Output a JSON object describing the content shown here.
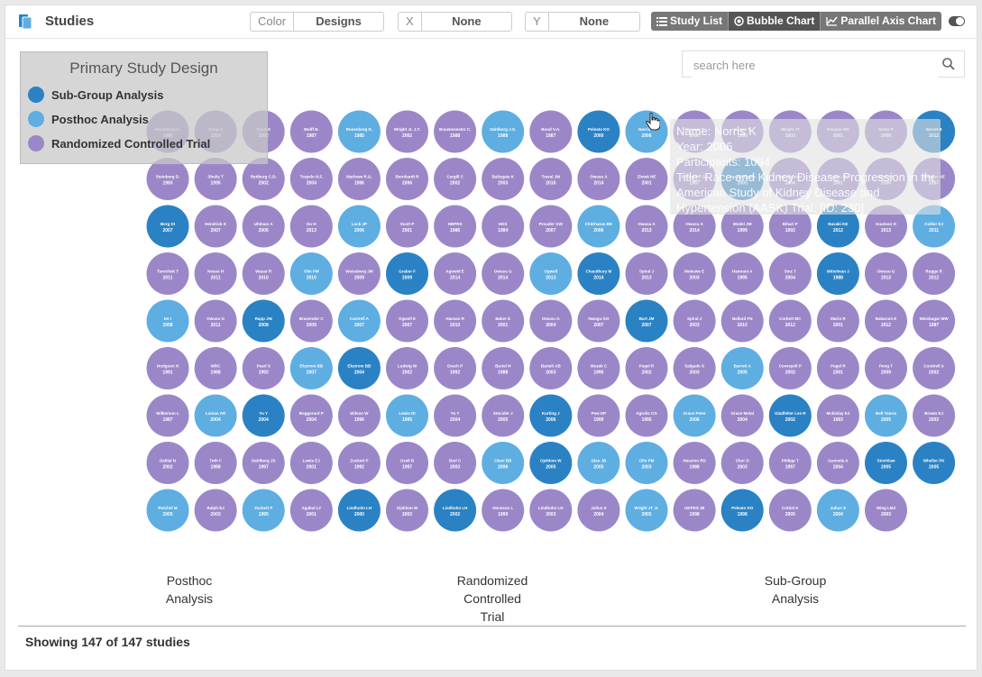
{
  "header": {
    "title": "Studies",
    "color_select": {
      "label": "Color",
      "value": "Designs"
    },
    "x_select": {
      "label": "X",
      "value": "None"
    },
    "y_select": {
      "label": "Y",
      "value": "None"
    },
    "view_buttons": [
      "Study List",
      "Bubble Chart",
      "Parallel Axis Chart"
    ],
    "active_view": "Bubble Chart"
  },
  "search": {
    "placeholder": "search here",
    "value": ""
  },
  "legend": {
    "title": "Primary Study Design",
    "items": [
      {
        "label": "Sub-Group Analysis",
        "color": "#2a82c4"
      },
      {
        "label": "Posthoc Analysis",
        "color": "#5eaee2"
      },
      {
        "label": "Randomized Controlled Trial",
        "color": "#9b87c8"
      }
    ]
  },
  "tooltip": {
    "lines": [
      "Name: Norris K",
      "Year: 2006",
      "Participants: 1094",
      "Title: Race and Kidney Disease Progression in the African",
      "American Study of Kidney Disease and",
      "Hypertension (AASK) Trial. [ID: 230]"
    ]
  },
  "group_labels": [
    {
      "lines": [
        "Posthoc",
        "Analysis"
      ]
    },
    {
      "lines": [
        "Randomized",
        "Controlled",
        "Trial"
      ]
    },
    {
      "lines": [
        "Sub-Group",
        "Analysis"
      ]
    }
  ],
  "footer": {
    "status": "Showing 147 of 147 studies"
  },
  "chart_data": {
    "type": "scatter",
    "title": "",
    "xlabel": "",
    "ylabel": "",
    "bubbles": [
      {
        "name": "Hirschhorn L",
        "year": "1986",
        "design": "R"
      },
      {
        "name": "Kang H",
        "year": "1993",
        "design": "R"
      },
      {
        "name": "Pearl S",
        "year": "1992",
        "design": "R"
      },
      {
        "name": "Wolff B.",
        "year": "1987",
        "design": "R"
      },
      {
        "name": "Rosenberg D.",
        "year": "1985",
        "design": "P"
      },
      {
        "name": "Wright Jr. J.T.",
        "year": "2002",
        "design": "R"
      },
      {
        "name": "Bouwmeester C.",
        "year": "1988",
        "design": "R"
      },
      {
        "name": "Dahlberg J.S.",
        "year": "1988",
        "design": "P"
      },
      {
        "name": "Bond V.A.",
        "year": "1987",
        "design": "R"
      },
      {
        "name": "Peleato KO",
        "year": "2000",
        "design": "S"
      },
      {
        "name": "Norris K",
        "year": "2006",
        "design": "P"
      },
      {
        "name": "Duncan T",
        "year": "2006",
        "design": "R"
      },
      {
        "name": "Grimm R",
        "year": "1998",
        "design": "R"
      },
      {
        "name": "Wright JT",
        "year": "2003",
        "design": "R"
      },
      {
        "name": "Kenyon RR",
        "year": "2001",
        "design": "R"
      },
      {
        "name": "Greer P",
        "year": "2006",
        "design": "R"
      },
      {
        "name": "Wendt B",
        "year": "2012",
        "design": "S"
      },
      {
        "name": "Steinberg D.",
        "year": "1993",
        "design": "R"
      },
      {
        "name": "Shultz T",
        "year": "1995",
        "design": "R"
      },
      {
        "name": "Rettberg C.D.",
        "year": "2002",
        "design": "R"
      },
      {
        "name": "Torpelo H.F.",
        "year": "2004",
        "design": "R"
      },
      {
        "name": "Marlowe R.G.",
        "year": "1986",
        "design": "R"
      },
      {
        "name": "Bernhardt R",
        "year": "2006",
        "design": "R"
      },
      {
        "name": "Cargill C",
        "year": "2002",
        "design": "R"
      },
      {
        "name": "Baltzgate K",
        "year": "2003",
        "design": "R"
      },
      {
        "name": "Traval JM",
        "year": "2016",
        "design": "R"
      },
      {
        "name": "Owusu A",
        "year": "2014",
        "design": "R"
      },
      {
        "name": "Zlotek NE",
        "year": "2001",
        "design": "R"
      },
      {
        "name": "Schneider GF",
        "year": "1987",
        "design": "R"
      },
      {
        "name": "Agaleb Bowie",
        "year": "2005",
        "design": "S"
      },
      {
        "name": "Del Winston",
        "year": "2004",
        "design": "R"
      },
      {
        "name": "Totten JM",
        "year": "2001",
        "design": "R"
      },
      {
        "name": "Bosch P",
        "year": "2006",
        "design": "R"
      },
      {
        "name": "Brenner AE",
        "year": "1987",
        "design": "R"
      },
      {
        "name": "Berg DI",
        "year": "2007",
        "design": "S"
      },
      {
        "name": "Hendrick K",
        "year": "2007",
        "design": "R"
      },
      {
        "name": "Uhlman A",
        "year": "2006",
        "design": "R"
      },
      {
        "name": "Do H",
        "year": "2013",
        "design": "R"
      },
      {
        "name": "Lock JP",
        "year": "2006",
        "design": "P"
      },
      {
        "name": "Scott P",
        "year": "2001",
        "design": "R"
      },
      {
        "name": "HBPRS",
        "year": "1986",
        "design": "R"
      },
      {
        "name": "HDS",
        "year": "1984",
        "design": "R"
      },
      {
        "name": "Prouder GW",
        "year": "2007",
        "design": "R"
      },
      {
        "name": "Chitrharan BK",
        "year": "2006",
        "design": "P"
      },
      {
        "name": "Owusu A",
        "year": "2013",
        "design": "R"
      },
      {
        "name": "Owusu A",
        "year": "2014",
        "design": "R"
      },
      {
        "name": "Model JM",
        "year": "1999",
        "design": "R"
      },
      {
        "name": "Bihari P",
        "year": "1992",
        "design": "R"
      },
      {
        "name": "Bavaki KE",
        "year": "2012",
        "design": "S"
      },
      {
        "name": "Kauteon H",
        "year": "2013",
        "design": "R"
      },
      {
        "name": "Collier EJ",
        "year": "2011",
        "design": "P"
      },
      {
        "name": "Turechek T",
        "year": "2011",
        "design": "R"
      },
      {
        "name": "Nesso H",
        "year": "2011",
        "design": "R"
      },
      {
        "name": "Wasar R",
        "year": "2010",
        "design": "R"
      },
      {
        "name": "Olin PM",
        "year": "2010",
        "design": "P"
      },
      {
        "name": "Weissberg JM",
        "year": "2009",
        "design": "R"
      },
      {
        "name": "Graber F",
        "year": "2009",
        "design": "S"
      },
      {
        "name": "Agowid E",
        "year": "2014",
        "design": "R"
      },
      {
        "name": "Owusu G",
        "year": "2014",
        "design": "R"
      },
      {
        "name": "Ogwell",
        "year": "2013",
        "design": "P"
      },
      {
        "name": "Chaudhury M",
        "year": "2014",
        "design": "S"
      },
      {
        "name": "Spiral J",
        "year": "2013",
        "design": "R"
      },
      {
        "name": "Mokuwe E",
        "year": "2003",
        "design": "R"
      },
      {
        "name": "Hamrani A",
        "year": "1995",
        "design": "R"
      },
      {
        "name": "Sinz T",
        "year": "2004",
        "design": "R"
      },
      {
        "name": "Mittelman J",
        "year": "1988",
        "design": "S"
      },
      {
        "name": "Owusu G",
        "year": "2013",
        "design": "R"
      },
      {
        "name": "Rugge R",
        "year": "2012",
        "design": "R"
      },
      {
        "name": "Do I",
        "year": "2008",
        "design": "P"
      },
      {
        "name": "Owusu G",
        "year": "2011",
        "design": "R"
      },
      {
        "name": "Rapp JW",
        "year": "2008",
        "design": "S"
      },
      {
        "name": "Bravender C",
        "year": "2009",
        "design": "R"
      },
      {
        "name": "Cantrell A",
        "year": "2007",
        "design": "P"
      },
      {
        "name": "Ogwell E",
        "year": "2007",
        "design": "R"
      },
      {
        "name": "Hassan R",
        "year": "2010",
        "design": "R"
      },
      {
        "name": "Baker E",
        "year": "2001",
        "design": "R"
      },
      {
        "name": "Owusu G",
        "year": "2004",
        "design": "R"
      },
      {
        "name": "Nwagu GO",
        "year": "2007",
        "design": "R"
      },
      {
        "name": "Burt JM",
        "year": "2007",
        "design": "S"
      },
      {
        "name": "Spiral J",
        "year": "2003",
        "design": "R"
      },
      {
        "name": "Ballard FN",
        "year": "2010",
        "design": "R"
      },
      {
        "name": "Corbett MC",
        "year": "2012",
        "design": "R"
      },
      {
        "name": "Marin R",
        "year": "2001",
        "design": "R"
      },
      {
        "name": "Bakarum E",
        "year": "2012",
        "design": "R"
      },
      {
        "name": "Weisbagar MW",
        "year": "1987",
        "design": "R"
      },
      {
        "name": "Hodgson H",
        "year": "1991",
        "design": "R"
      },
      {
        "name": "MRC",
        "year": "1988",
        "design": "R"
      },
      {
        "name": "Pearl S",
        "year": "1992",
        "design": "R"
      },
      {
        "name": "Ekstrom BB",
        "year": "2007",
        "design": "P"
      },
      {
        "name": "Ekstrom BB",
        "year": "2004",
        "design": "S"
      },
      {
        "name": "Ludwig W",
        "year": "2002",
        "design": "R"
      },
      {
        "name": "Drach P",
        "year": "1992",
        "design": "R"
      },
      {
        "name": "Bartel H",
        "year": "1988",
        "design": "R"
      },
      {
        "name": "Bartelt AB",
        "year": "2003",
        "design": "R"
      },
      {
        "name": "Wezek C",
        "year": "1995",
        "design": "R"
      },
      {
        "name": "Pagel R",
        "year": "2002",
        "design": "R"
      },
      {
        "name": "Salgado S",
        "year": "2003",
        "design": "R"
      },
      {
        "name": "Barrett A",
        "year": "2005",
        "design": "P"
      },
      {
        "name": "Coverpoll P",
        "year": "2002",
        "design": "R"
      },
      {
        "name": "Pagel R",
        "year": "2001",
        "design": "R"
      },
      {
        "name": "Peng T",
        "year": "2009",
        "design": "R"
      },
      {
        "name": "Condrell A",
        "year": "2002",
        "design": "R"
      },
      {
        "name": "Wilkerson L",
        "year": "1987",
        "design": "R"
      },
      {
        "name": "Luman AR",
        "year": "2004",
        "design": "P"
      },
      {
        "name": "Yu Y",
        "year": "2004",
        "design": "S"
      },
      {
        "name": "Boggerard P",
        "year": "2004",
        "design": "R"
      },
      {
        "name": "Wilson W",
        "year": "1996",
        "design": "R"
      },
      {
        "name": "Lewis DI",
        "year": "1995",
        "design": "P"
      },
      {
        "name": "Yu Y",
        "year": "2004",
        "design": "R"
      },
      {
        "name": "Stocider J",
        "year": "2005",
        "design": "R"
      },
      {
        "name": "Kurting J",
        "year": "2006",
        "design": "S"
      },
      {
        "name": "Pew DP",
        "year": "1999",
        "design": "R"
      },
      {
        "name": "Agrolis CG",
        "year": "1995",
        "design": "R"
      },
      {
        "name": "Grace Peter",
        "year": "2006",
        "design": "P"
      },
      {
        "name": "Grace Metal",
        "year": "2004",
        "design": "R"
      },
      {
        "name": "Gladfelter Lee R",
        "year": "2002",
        "design": "S"
      },
      {
        "name": "Mckinlay EJ",
        "year": "1993",
        "design": "R"
      },
      {
        "name": "Bell Tamra",
        "year": "2005",
        "design": "P"
      },
      {
        "name": "Brown EJ",
        "year": "2002",
        "design": "R"
      },
      {
        "name": "Dahlal N",
        "year": "2002",
        "design": "R"
      },
      {
        "name": "Toth F",
        "year": "1988",
        "design": "R"
      },
      {
        "name": "Dahlberg JS",
        "year": "1997",
        "design": "R"
      },
      {
        "name": "Lewis EJ",
        "year": "2001",
        "design": "R"
      },
      {
        "name": "Zuckett P",
        "year": "1992",
        "design": "R"
      },
      {
        "name": "Ozell B",
        "year": "1997",
        "design": "R"
      },
      {
        "name": "Barl C",
        "year": "2003",
        "design": "R"
      },
      {
        "name": "Olani BB",
        "year": "2006",
        "design": "P"
      },
      {
        "name": "Ojeblom W",
        "year": "2005",
        "design": "S"
      },
      {
        "name": "Glee JB",
        "year": "2005",
        "design": "P"
      },
      {
        "name": "Olin PM",
        "year": "2003",
        "design": "P"
      },
      {
        "name": "Hession RD",
        "year": "1988",
        "design": "R"
      },
      {
        "name": "Chui JI",
        "year": "2003",
        "design": "R"
      },
      {
        "name": "Philipp T",
        "year": "1997",
        "design": "R"
      },
      {
        "name": "Gunnels A",
        "year": "2004",
        "design": "R"
      },
      {
        "name": "Stochlaw",
        "year": "2005",
        "design": "S"
      },
      {
        "name": "Wheller PK",
        "year": "2005",
        "design": "S"
      },
      {
        "name": "Retchel M",
        "year": "2005",
        "design": "P"
      },
      {
        "name": "Ralph EJ",
        "year": "2003",
        "design": "R"
      },
      {
        "name": "Zuckett P",
        "year": "1995",
        "design": "P"
      },
      {
        "name": "Agabul LY",
        "year": "2001",
        "design": "R"
      },
      {
        "name": "Lindholm LH",
        "year": "2000",
        "design": "S"
      },
      {
        "name": "Ojeblom W",
        "year": "2002",
        "design": "R"
      },
      {
        "name": "Lindholm LH",
        "year": "2002",
        "design": "S"
      },
      {
        "name": "Hansson L",
        "year": "1999",
        "design": "R"
      },
      {
        "name": "Lindholm LH",
        "year": "2003",
        "design": "R"
      },
      {
        "name": "Julius S",
        "year": "2004",
        "design": "R"
      },
      {
        "name": "Wright JT Jr.",
        "year": "2005",
        "design": "P"
      },
      {
        "name": "UKPDS 38",
        "year": "1998",
        "design": "R"
      },
      {
        "name": "Peleato KO",
        "year": "1998",
        "design": "S"
      },
      {
        "name": "Cottiel K",
        "year": "2005",
        "design": "R"
      },
      {
        "name": "Julius S",
        "year": "2004",
        "design": "P"
      },
      {
        "name": "Wing LMJ",
        "year": "2003",
        "design": "R"
      }
    ]
  }
}
